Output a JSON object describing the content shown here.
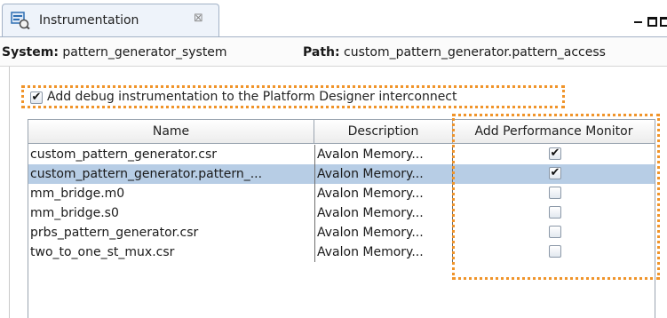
{
  "tab": {
    "title": "Instrumentation",
    "close_glyph": "⊠",
    "icon": "instrumentation-icon"
  },
  "window_controls": [
    "minimize-icon",
    "maximize-icon",
    "restore-icon"
  ],
  "info": {
    "system_label": "System:",
    "system_value": "pattern_generator_system",
    "path_label": "Path:",
    "path_value": "custom_pattern_generator.pattern_access"
  },
  "debug_option": {
    "label": "Add debug instrumentation to the Platform Designer interconnect",
    "checked": true,
    "check_glyph": "✔"
  },
  "table": {
    "headers": {
      "name": "Name",
      "description": "Description",
      "perf": "Add Performance Monitor"
    },
    "rows": [
      {
        "name": "custom_pattern_generator.csr",
        "description": "Avalon Memory...",
        "perf": "✔",
        "selected": false
      },
      {
        "name": "custom_pattern_generator.pattern_...",
        "description": "Avalon Memory...",
        "perf": "✔",
        "selected": true
      },
      {
        "name": "mm_bridge.m0",
        "description": "Avalon Memory...",
        "perf": "",
        "selected": false
      },
      {
        "name": "mm_bridge.s0",
        "description": "Avalon Memory...",
        "perf": "",
        "selected": false
      },
      {
        "name": "prbs_pattern_generator.csr",
        "description": "Avalon Memory...",
        "perf": "",
        "selected": false
      },
      {
        "name": "two_to_one_st_mux.csr",
        "description": "Avalon Memory...",
        "perf": "",
        "selected": false
      }
    ]
  },
  "colors": {
    "highlight_outline": "#f0942a",
    "selected_row": "#b7cde5",
    "tab_background": "#eef3fa"
  }
}
